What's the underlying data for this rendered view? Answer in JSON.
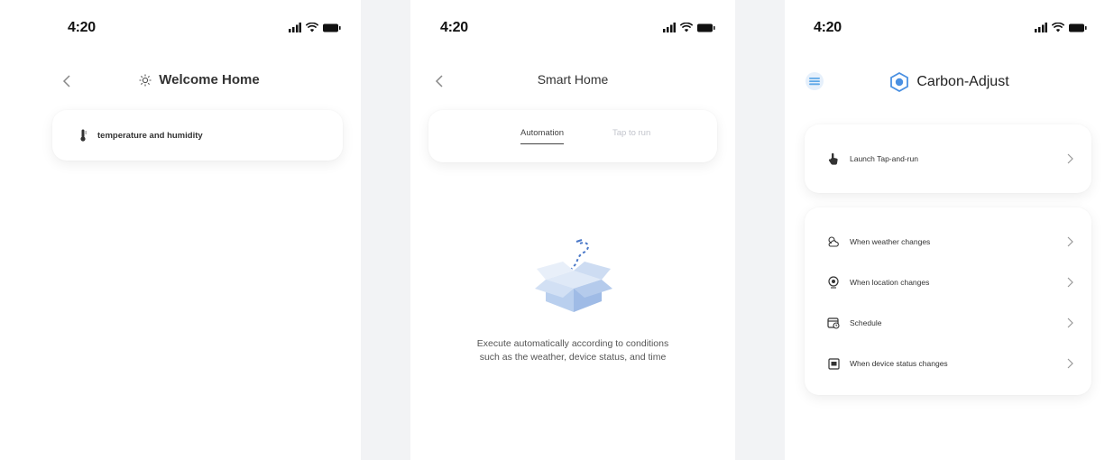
{
  "status_bar": {
    "time": "4:20"
  },
  "screen1": {
    "title": "Welcome Home",
    "card_item": "temperature and humidity"
  },
  "screen2": {
    "title": "Smart Home",
    "tabs": [
      {
        "label": "Automation",
        "active": true
      },
      {
        "label": "Tap to run",
        "active": false
      }
    ],
    "empty_description_line1": "Execute automatically according to conditions",
    "empty_description_line2": "such as the weather, device status, and time"
  },
  "screen3": {
    "title": "Carbon-Adjust",
    "launch_item": "Launch  Tap-and-run",
    "conditions": [
      {
        "label": "When weather changes",
        "icon": "weather-icon"
      },
      {
        "label": "When location changes",
        "icon": "location-pin-icon"
      },
      {
        "label": "Schedule",
        "icon": "calendar-clock-icon"
      },
      {
        "label": "When device status changes",
        "icon": "device-icon"
      }
    ]
  },
  "colors": {
    "accent_blue": "#4a90e2",
    "menu_blue": "#5fa8e8",
    "tab_inactive": "#c2c4cc",
    "strip_gray": "#f2f3f5"
  }
}
